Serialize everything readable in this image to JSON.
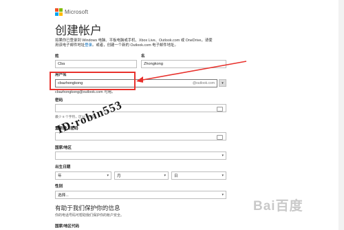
{
  "header": {
    "logo_text": "Microsoft",
    "title": "创建帐户"
  },
  "intro": {
    "text_1": "如果你已登录到 Windows 电脑、平板电脑或手机、Xbox Live、Outlook.com 或 OneDrive，请使",
    "text_2": "用该电子邮件地址",
    "link": "登录",
    "text_3": "。或者，创建一个新的 Outlook.com 电子邮件地址。"
  },
  "name": {
    "last_label": "姓",
    "last_value": "Cba",
    "first_label": "名",
    "first_value": "Zhongkong"
  },
  "username": {
    "label": "用户名",
    "value": "cbazhongkong",
    "domain": "@outlook.com",
    "available_msg": "cbazhongkong@outlook.com 可用。"
  },
  "password": {
    "label": "密码",
    "hint": "最少 8 个字符，区分大小写"
  },
  "password_confirm": {
    "label": "重新输入密码"
  },
  "country": {
    "label": "国家/地区",
    "value": ""
  },
  "birth": {
    "label": "出生日期",
    "year": "年",
    "month": "月",
    "day": "日"
  },
  "gender": {
    "label": "性别",
    "value": "选择..."
  },
  "protect": {
    "title": "有助于我们保护你的信息",
    "subtitle": "你的电话号码可帮助我们保护你的帐户安全。"
  },
  "phone_country": {
    "label": "国家/地区代码"
  },
  "watermark": "ID:robin553",
  "baidu_watermark": "Bai百度",
  "colors": {
    "annotation_red": "#e8302b",
    "link_blue": "#0067b8"
  }
}
